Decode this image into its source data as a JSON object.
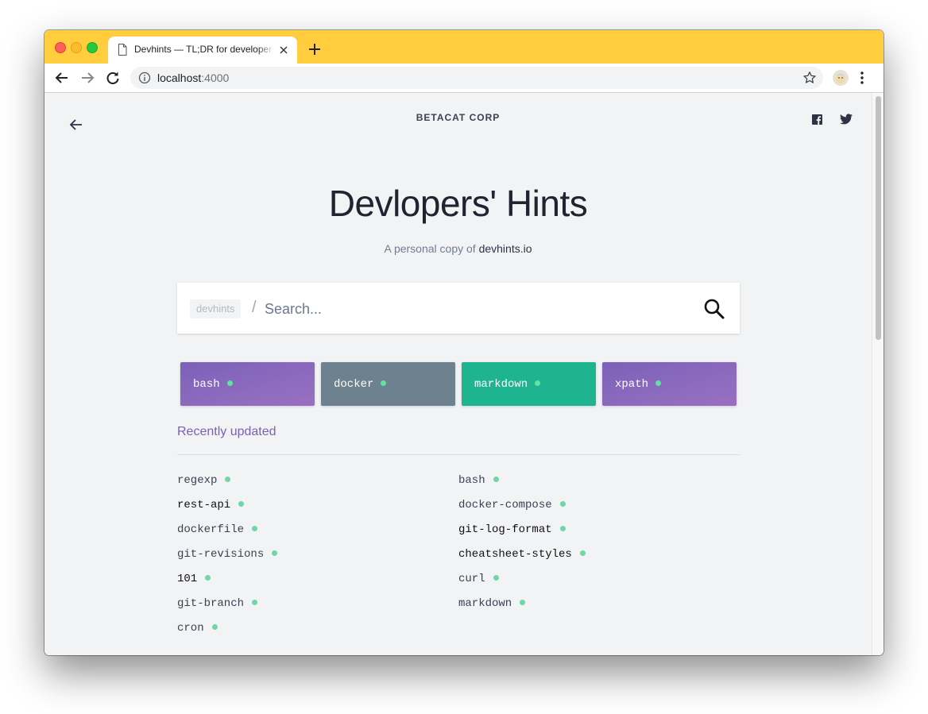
{
  "browser": {
    "tab_title": "Devhints — TL;DR for developer cheatsheets",
    "url_host": "localhost",
    "url_port": ":4000"
  },
  "header": {
    "brand": "BETACAT CORP"
  },
  "hero": {
    "title": "Devlopers' Hints",
    "subtitle_prefix": "A personal copy of",
    "subtitle_link": "devhints.io"
  },
  "search": {
    "prefix": "devhints",
    "slash": "/",
    "placeholder": "Search..."
  },
  "featured": [
    {
      "label": "bash",
      "color": "purple"
    },
    {
      "label": "docker",
      "color": "gray"
    },
    {
      "label": "markdown",
      "color": "green"
    },
    {
      "label": "xpath",
      "color": "purple"
    }
  ],
  "recently_updated": {
    "title": "Recently updated",
    "left": [
      "regexp",
      "rest-api",
      "dockerfile",
      "git-revisions",
      "101",
      "git-branch",
      "cron"
    ],
    "right": [
      "bash",
      "docker-compose",
      "git-log-format",
      "cheatsheet-styles",
      "curl",
      "markdown"
    ]
  },
  "colors": {
    "chrome_accent": "#ffcd3d",
    "card_purple": "#8d6bbe",
    "card_gray": "#6d818f",
    "card_green": "#1eb48f",
    "dot_green": "#6fd7a5",
    "section_title": "#7a61b3"
  }
}
